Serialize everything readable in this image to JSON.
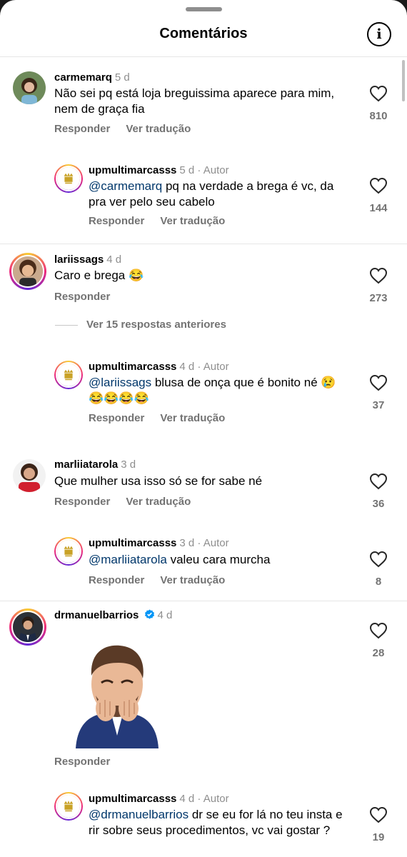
{
  "header": {
    "title": "Comentários",
    "info_icon": "info-icon",
    "info_glyph": "i"
  },
  "comments": [
    {
      "username": "carmemarq",
      "meta": "5 d",
      "text": "Não sei pq está loja breguissima aparece para mim, nem de graça fia",
      "reply_label": "Responder",
      "translate_label": "Ver tradução",
      "likes": "810"
    },
    {
      "username": "upmultimarcasss",
      "meta": "5 d · Autor",
      "mention": "@carmemarq",
      "text": " pq na verdade a brega é vc, da pra ver pelo seu cabelo",
      "reply_label": "Responder",
      "translate_label": "Ver tradução",
      "likes": "144"
    },
    {
      "username": "lariissags",
      "meta": "4 d",
      "text": "Caro e brega 😂",
      "reply_label": "Responder",
      "likes": "273"
    },
    {
      "username": "upmultimarcasss",
      "meta": "4 d · Autor",
      "mention": "@lariissags",
      "text": " blusa de onça que é bonito né 😢 😂😂😂😂",
      "reply_label": "Responder",
      "translate_label": "Ver tradução",
      "likes": "37"
    },
    {
      "username": "marliiatarola",
      "meta": "3 d",
      "text": "Que  mulher usa isso só se for sabe né",
      "reply_label": "Responder",
      "translate_label": "Ver tradução",
      "likes": "36"
    },
    {
      "username": "upmultimarcasss",
      "meta": "3 d · Autor",
      "mention": "@marliiatarola",
      "text": " valeu cara murcha",
      "reply_label": "Responder",
      "translate_label": "Ver tradução",
      "likes": "8"
    },
    {
      "username": "drmanuelbarrios",
      "meta": "4 d",
      "verified_icon": "verified-badge-icon",
      "sticker": "laughing-memoji-sticker",
      "reply_label": "Responder",
      "likes": "28"
    },
    {
      "username": "upmultimarcasss",
      "meta": "4 d · Autor",
      "mention": "@drmanuelbarrios",
      "text": " dr se eu for lá no teu insta e rir  sobre seus procedimentos, vc vai gostar ?",
      "reply_label": "Responder",
      "likes": "19"
    }
  ],
  "view_more_replies": "Ver 15 respostas anteriores",
  "colors": {
    "mention": "#00376b",
    "secondary_text": "#737373",
    "verified": "#0095f6",
    "story_ring": [
      "#f9ce34",
      "#ee2a7b",
      "#6228d7"
    ]
  }
}
